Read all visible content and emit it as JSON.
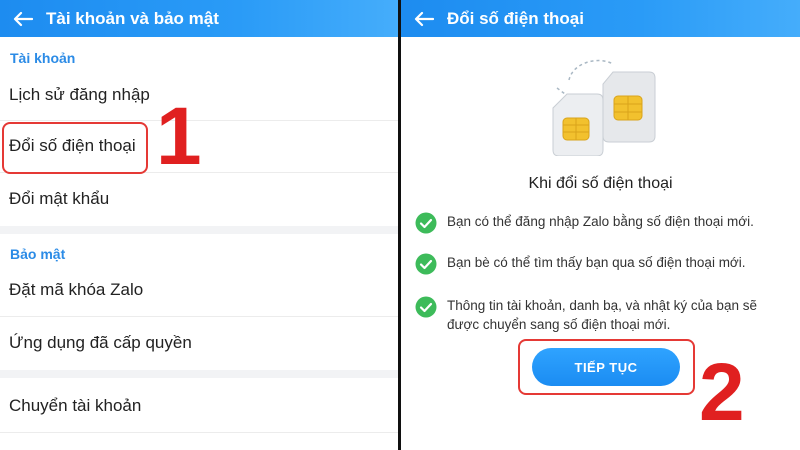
{
  "left": {
    "title": "Tài khoản và bảo mật",
    "section_account": "Tài khoản",
    "items_account": [
      "Lịch sử đăng nhập",
      "Đổi số điện thoại",
      "Đổi mật khẩu"
    ],
    "section_security": "Bảo mật",
    "items_security": [
      "Đặt mã khóa Zalo",
      "Ứng dụng đã cấp quyền"
    ],
    "item_switch": "Chuyển tài khoản",
    "step_number": "1"
  },
  "right": {
    "title": "Đổi số điện thoại",
    "heading": "Khi đổi số điện thoại",
    "benefits": [
      "Bạn có thể đăng nhập Zalo bằng số điện thoại mới.",
      "Bạn bè có thể tìm thấy bạn qua số điện thoại mới.",
      "Thông tin tài khoản, danh bạ, và nhật ký của bạn sẽ được chuyển sang số điện thoại mới."
    ],
    "continue_label": "TIẾP TỤC",
    "step_number": "2"
  },
  "colors": {
    "header": "#1d8cf0",
    "section": "#2b8be6",
    "check": "#3dbb5a",
    "highlight": "#e53935"
  }
}
